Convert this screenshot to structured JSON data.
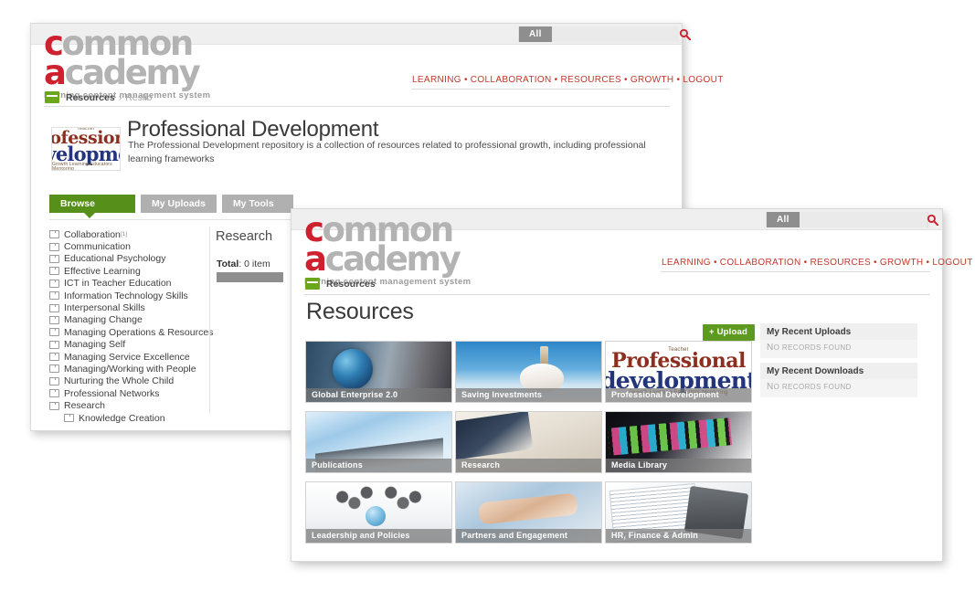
{
  "brand": {
    "line1_red": "c",
    "line1_rest": "ommon",
    "line2_red": "a",
    "line2_rest": "cademy",
    "tagline": "learning content management system"
  },
  "search": {
    "scope_label": "All",
    "value": "",
    "placeholder": "",
    "icon": "search-icon"
  },
  "topnav": {
    "items": [
      "LEARNING",
      "COLLABORATION",
      "RESOURCES",
      "GROWTH",
      "LOGOUT"
    ],
    "separator": "•",
    "link_color": "#c0392b"
  },
  "window_back": {
    "breadcrumb": {
      "icon": "folder-icon",
      "root": "Resources",
      "separator": "›",
      "current": "Reslib"
    },
    "repository": {
      "title": "Professional Development",
      "description": "The Professional Development repository is a collection of resources related to professional growth, including professional learning frameworks",
      "thumbnail_alt": "professional-development-word-cloud"
    },
    "tabs": [
      {
        "label": "Browse",
        "active": true
      },
      {
        "label": "My Uploads",
        "active": false
      },
      {
        "label": "My Tools",
        "active": false
      }
    ],
    "tree": [
      {
        "label": "Collaboration",
        "badge": "[1]",
        "indent": false
      },
      {
        "label": "Communication",
        "badge": "",
        "indent": false
      },
      {
        "label": "Educational Psychology",
        "badge": "",
        "indent": false
      },
      {
        "label": "Effective Learning",
        "badge": "",
        "indent": false
      },
      {
        "label": "ICT in Teacher Education",
        "badge": "",
        "indent": false
      },
      {
        "label": "Information Technology Skills",
        "badge": "",
        "indent": false
      },
      {
        "label": "Interpersonal Skills",
        "badge": "",
        "indent": false
      },
      {
        "label": "Managing Change",
        "badge": "",
        "indent": false
      },
      {
        "label": "Managing Operations & Resources",
        "badge": "",
        "indent": false
      },
      {
        "label": "Managing Self",
        "badge": "",
        "indent": false
      },
      {
        "label": "Managing Service Excellence",
        "badge": "",
        "indent": false
      },
      {
        "label": "Managing/Working with People",
        "badge": "",
        "indent": false
      },
      {
        "label": "Nurturing the Whole Child",
        "badge": "",
        "indent": false
      },
      {
        "label": "Professional Networks",
        "badge": "",
        "indent": false
      },
      {
        "label": "Research",
        "badge": "",
        "indent": false
      },
      {
        "label": "Knowledge Creation",
        "badge": "",
        "indent": true
      }
    ],
    "detail": {
      "title": "Research",
      "total_label": "Total",
      "total_value": ": 0 item"
    }
  },
  "window_front": {
    "breadcrumb": {
      "icon": "folder-icon",
      "root": "Resources"
    },
    "page_title": "Resources",
    "upload_button": "+ Upload",
    "tiles": [
      {
        "caption": "Global Enterprise 2.0",
        "art": "art-globe"
      },
      {
        "caption": "Saving Investments",
        "art": "art-piggy"
      },
      {
        "caption": "Professional Development",
        "art": "art-profdev"
      },
      {
        "caption": "Publications",
        "art": "art-publications"
      },
      {
        "caption": "Research",
        "art": "art-research"
      },
      {
        "caption": "Media Library",
        "art": "art-media"
      },
      {
        "caption": "Leadership and Policies",
        "art": "art-leadership"
      },
      {
        "caption": "Partners and Engagement",
        "art": "art-partners"
      },
      {
        "caption": "HR, Finance & Admin",
        "art": "art-hr"
      }
    ],
    "rail": [
      {
        "title": "My Recent Uploads",
        "empty_first": "N",
        "empty_rest": "O RECORDS FOUND"
      },
      {
        "title": "My Recent Downloads",
        "empty_first": "N",
        "empty_rest": "O RECORDS FOUND"
      }
    ]
  },
  "wordcloud": {
    "top_small": "Teacher",
    "big1": "Professional",
    "big2": "development",
    "bottom_small": "Growth  Learning  Educators  Mentoring"
  },
  "colors": {
    "brand_red": "#cf2030",
    "brand_grey": "#b3b3b3",
    "green": "#56901a",
    "nav_red": "#c0392b"
  }
}
